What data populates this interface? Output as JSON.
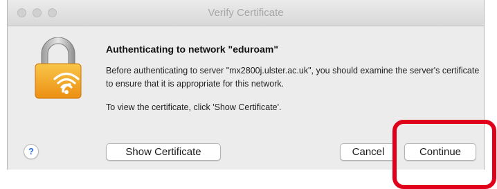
{
  "window": {
    "title": "Verify Certificate"
  },
  "dialog": {
    "heading": "Authenticating to network \"eduroam\"",
    "body": "Before authenticating to server \"mx2800j.ulster.ac.uk\", you should examine the server's certificate to ensure that it is appropriate for this network.",
    "hint": "To view the certificate, click 'Show Certificate'.",
    "icon": "lock-wifi-icon"
  },
  "buttons": {
    "help_label": "?",
    "show_certificate_label": "Show Certificate",
    "cancel_label": "Cancel",
    "continue_label": "Continue"
  },
  "annotation": {
    "highlight_color": "#e0001a",
    "highlights": "continue-button"
  },
  "colors": {
    "window_background": "#ececec",
    "lock_body": "#f2a21c",
    "help_icon": "#2f6fdb"
  }
}
